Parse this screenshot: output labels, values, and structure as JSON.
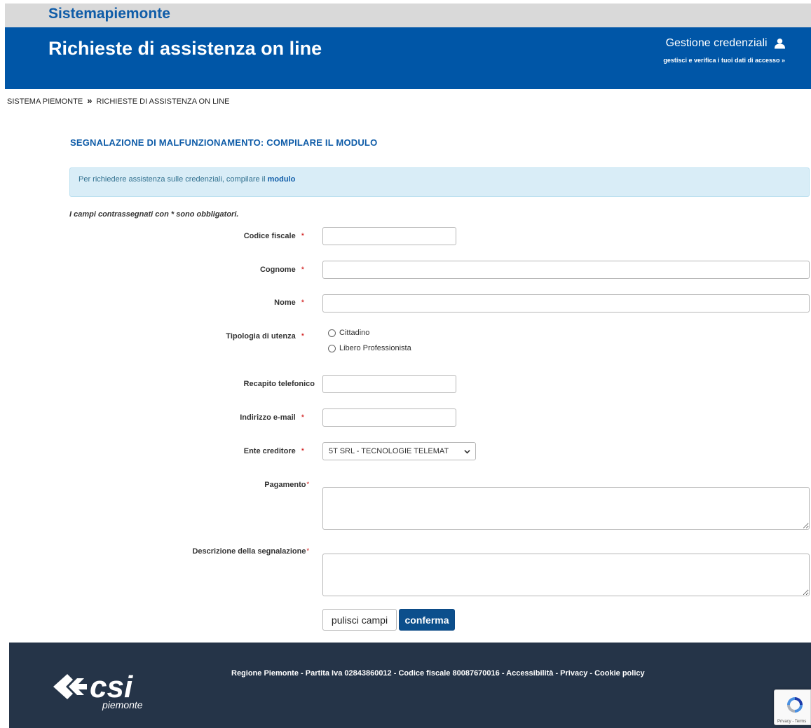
{
  "brand": "Sistemapiemonte",
  "header": {
    "title": "Richieste di assistenza on line",
    "credentials_title": "Gestione credenziali",
    "credentials_sub": "gestisci e verifica i tuoi dati di accesso »"
  },
  "breadcrumb": {
    "item1": "SISTEMA PIEMONTE",
    "separator": "»",
    "item2": "RICHIESTE DI ASSISTENZA ON LINE"
  },
  "page_title": "SEGNALAZIONE DI MALFUNZIONAMENTO: COMPILARE IL MODULO",
  "info": {
    "text": "Per richiedere assistenza sulle credenziali, compilare il ",
    "link": "modulo"
  },
  "required_note": "I campi contrassegnati con * sono obbligatori.",
  "form": {
    "required_mark": "*",
    "codice_fiscale_label": "Codice fiscale",
    "codice_fiscale_value": "",
    "cognome_label": "Cognome",
    "cognome_value": "",
    "nome_label": "Nome",
    "nome_value": "",
    "tipologia_label": "Tipologia di utenza",
    "tipologia_options": [
      "Cittadino",
      "Libero Professionista"
    ],
    "recapito_label": "Recapito telefonico",
    "recapito_value": "",
    "email_label": "Indirizzo e-mail",
    "email_value": "",
    "ente_label": "Ente creditore",
    "ente_selected": "5T SRL - TECNOLOGIE TELEMAT",
    "pagamento_label": "Pagamento",
    "descrizione_label": "Descrizione della segnalazione",
    "clear_button": "pulisci campi",
    "confirm_button": "conferma"
  },
  "footer": {
    "links_text": "Regione Piemonte - Partita Iva 02843860012 - Codice fiscale 80087670016 - Accessibilità - Privacy - Cookie policy",
    "logo_text": "csi",
    "logo_sub": "piemonte"
  },
  "recaptcha": {
    "text": "Privacy - Terms"
  },
  "colors": {
    "header_blue": "#0056a7",
    "title_blue": "#0f5ca8",
    "footer_bg": "#253448",
    "confirm_bg": "#0c4f8c"
  }
}
